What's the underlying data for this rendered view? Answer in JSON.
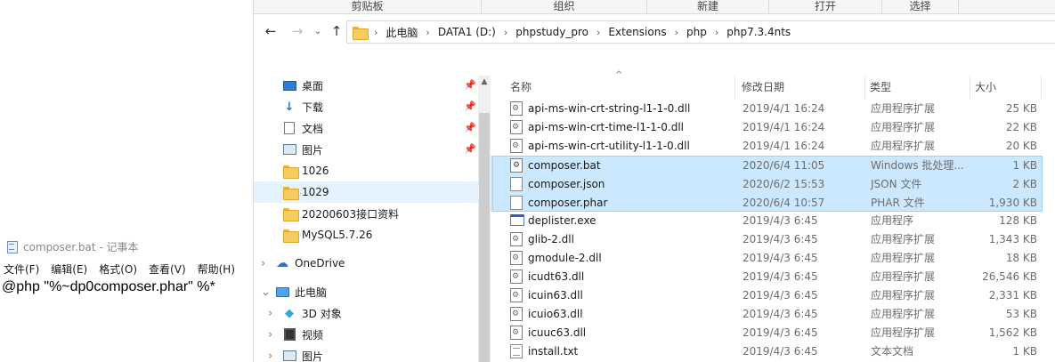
{
  "notepad": {
    "title": "composer.bat - 记事本",
    "menu": [
      "文件(F)",
      "编辑(E)",
      "格式(O)",
      "查看(V)",
      "帮助(H)"
    ],
    "content": "@php \"%~dp0composer.phar\" %*"
  },
  "ribbon": {
    "groups": [
      "剪贴板",
      "组织",
      "新建",
      "打开",
      "选择"
    ]
  },
  "address": {
    "path": [
      "此电脑",
      "DATA1 (D:)",
      "phpstudy_pro",
      "Extensions",
      "php",
      "php7.3.4nts"
    ]
  },
  "navpane": {
    "items": [
      {
        "label": "桌面",
        "icon": "desktop-icon",
        "pinned": true
      },
      {
        "label": "下载",
        "icon": "download-icon",
        "pinned": true
      },
      {
        "label": "文档",
        "icon": "documents-icon",
        "pinned": true
      },
      {
        "label": "图片",
        "icon": "pictures-icon",
        "pinned": true
      },
      {
        "label": "1026",
        "icon": "folder-icon",
        "pinned": false
      },
      {
        "label": "1029",
        "icon": "folder-icon",
        "pinned": false
      },
      {
        "label": "20200603接口资料",
        "icon": "folder-icon",
        "pinned": false
      },
      {
        "label": "MySQL5.7.26",
        "icon": "folder-icon",
        "pinned": false
      },
      {
        "label": "OneDrive",
        "icon": "onedrive-icon",
        "pinned": false
      },
      {
        "label": "此电脑",
        "icon": "this-pc-icon",
        "pinned": false
      },
      {
        "label": "3D 对象",
        "icon": "3d-objects-icon",
        "pinned": false
      },
      {
        "label": "视频",
        "icon": "videos-icon",
        "pinned": false
      },
      {
        "label": "图片",
        "icon": "pictures-icon",
        "pinned": false
      }
    ]
  },
  "columns": {
    "name": "名称",
    "date": "修改日期",
    "type": "类型",
    "size": "大小"
  },
  "files": [
    {
      "name": "api-ms-win-crt-string-l1-1-0.dll",
      "date": "2019/4/1 16:24",
      "type": "应用程序扩展",
      "size": "25 KB",
      "icon": "dll-icon"
    },
    {
      "name": "api-ms-win-crt-time-l1-1-0.dll",
      "date": "2019/4/1 16:24",
      "type": "应用程序扩展",
      "size": "22 KB",
      "icon": "dll-icon"
    },
    {
      "name": "api-ms-win-crt-utility-l1-1-0.dll",
      "date": "2019/4/1 16:24",
      "type": "应用程序扩展",
      "size": "20 KB",
      "icon": "dll-icon"
    },
    {
      "name": "composer.bat",
      "date": "2020/6/4 11:05",
      "type": "Windows 批处理...",
      "size": "1 KB",
      "icon": "batch-file-icon"
    },
    {
      "name": "composer.json",
      "date": "2020/6/2 15:53",
      "type": "JSON 文件",
      "size": "2 KB",
      "icon": "file-icon"
    },
    {
      "name": "composer.phar",
      "date": "2020/6/4 10:57",
      "type": "PHAR 文件",
      "size": "1,930 KB",
      "icon": "file-icon"
    },
    {
      "name": "deplister.exe",
      "date": "2019/4/3 6:45",
      "type": "应用程序",
      "size": "128 KB",
      "icon": "exe-icon"
    },
    {
      "name": "glib-2.dll",
      "date": "2019/4/3 6:45",
      "type": "应用程序扩展",
      "size": "1,343 KB",
      "icon": "dll-icon"
    },
    {
      "name": "gmodule-2.dll",
      "date": "2019/4/3 6:45",
      "type": "应用程序扩展",
      "size": "18 KB",
      "icon": "dll-icon"
    },
    {
      "name": "icudt63.dll",
      "date": "2019/4/3 6:45",
      "type": "应用程序扩展",
      "size": "26,546 KB",
      "icon": "dll-icon"
    },
    {
      "name": "icuin63.dll",
      "date": "2019/4/3 6:45",
      "type": "应用程序扩展",
      "size": "2,331 KB",
      "icon": "dll-icon"
    },
    {
      "name": "icuio63.dll",
      "date": "2019/4/3 6:45",
      "type": "应用程序扩展",
      "size": "53 KB",
      "icon": "dll-icon"
    },
    {
      "name": "icuuc63.dll",
      "date": "2019/4/3 6:45",
      "type": "应用程序扩展",
      "size": "1,562 KB",
      "icon": "dll-icon"
    },
    {
      "name": "install.txt",
      "date": "2019/4/3 6:45",
      "type": "文本文档",
      "size": "1 KB",
      "icon": "text-file-icon"
    }
  ],
  "colors": {
    "selection": "#cce8ff",
    "nav_selected": "#e5f3ff",
    "folder": "#f6cd5c"
  }
}
